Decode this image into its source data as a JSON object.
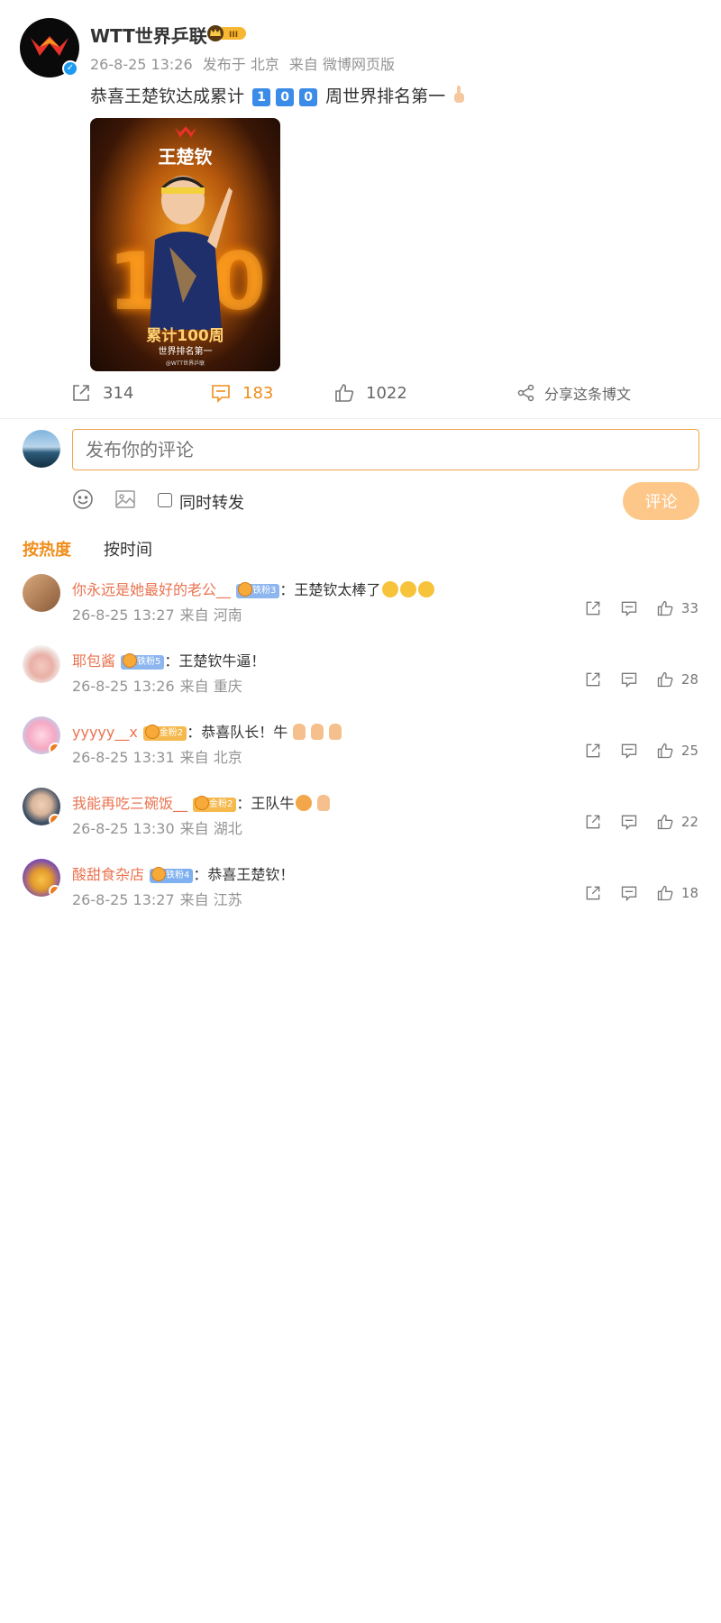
{
  "post": {
    "author_name": "WTT世界乒联",
    "meta": {
      "time": "26-8-25 13:26",
      "location": "发布于 北京",
      "source": "来自 微博网页版"
    },
    "text_before": "恭喜王楚钦达成累计",
    "digits": [
      "1",
      "0",
      "0"
    ],
    "text_after": "周世界排名第一",
    "image": {
      "name": "王楚钦",
      "big_number": "100",
      "title": "累计100周",
      "subtitle": "世界排名第一",
      "watermark": "@WTT世界乒联"
    }
  },
  "actions": {
    "repost_count": "314",
    "comment_count": "183",
    "like_count": "1022",
    "share_label": "分享这条博文"
  },
  "composer": {
    "placeholder": "发布你的评论",
    "repost_label": "同时转发",
    "submit_label": "评论"
  },
  "sort": {
    "hot": "按热度",
    "time": "按时间"
  },
  "comments": [
    {
      "user": "你永远是她最好的老公__",
      "badge": "铁粉3",
      "text": "：王楚钦太棒了",
      "time": "26-8-25 13:27",
      "from": "来自 河南",
      "likes": "33"
    },
    {
      "user": "耶包酱",
      "badge": "铁粉5",
      "text": "：王楚钦牛逼！",
      "time": "26-8-25 13:26",
      "from": "来自 重庆",
      "likes": "28"
    },
    {
      "user": "yyyyy__x",
      "badge": "金粉2",
      "text": "：恭喜队长！牛",
      "time": "26-8-25 13:31",
      "from": "来自 北京",
      "likes": "25"
    },
    {
      "user": "我能再吃三碗饭__",
      "badge": "金粉2",
      "text": "：王队牛",
      "time": "26-8-25 13:30",
      "from": "来自 湖北",
      "likes": "22"
    },
    {
      "user": "酸甜食杂店",
      "badge": "铁粉4",
      "text": "：恭喜王楚钦！",
      "time": "26-8-25 13:27",
      "from": "来自 江苏",
      "likes": "18"
    }
  ],
  "colors": {
    "accent": "#f08d1a",
    "username": "#eb7350",
    "button": "#fdc78a",
    "verified": "#1d9bf0"
  }
}
